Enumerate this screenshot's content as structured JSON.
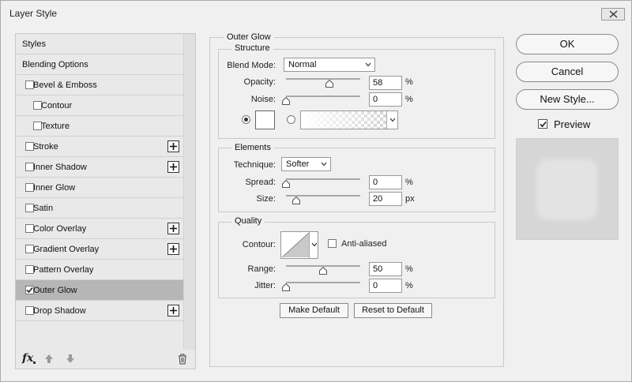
{
  "window": {
    "title": "Layer Style"
  },
  "sidebar": {
    "items": [
      {
        "label": "Styles",
        "checkbox": false,
        "checked": false,
        "indent": 0,
        "plus": false,
        "selected": false
      },
      {
        "label": "Blending Options",
        "checkbox": false,
        "checked": false,
        "indent": 0,
        "plus": false,
        "selected": false
      },
      {
        "label": "Bevel & Emboss",
        "checkbox": true,
        "checked": false,
        "indent": 0,
        "plus": false,
        "selected": false
      },
      {
        "label": "Contour",
        "checkbox": true,
        "checked": false,
        "indent": 1,
        "plus": false,
        "selected": false
      },
      {
        "label": "Texture",
        "checkbox": true,
        "checked": false,
        "indent": 1,
        "plus": false,
        "selected": false
      },
      {
        "label": "Stroke",
        "checkbox": true,
        "checked": false,
        "indent": 0,
        "plus": true,
        "selected": false
      },
      {
        "label": "Inner Shadow",
        "checkbox": true,
        "checked": false,
        "indent": 0,
        "plus": true,
        "selected": false
      },
      {
        "label": "Inner Glow",
        "checkbox": true,
        "checked": false,
        "indent": 0,
        "plus": false,
        "selected": false
      },
      {
        "label": "Satin",
        "checkbox": true,
        "checked": false,
        "indent": 0,
        "plus": false,
        "selected": false
      },
      {
        "label": "Color Overlay",
        "checkbox": true,
        "checked": false,
        "indent": 0,
        "plus": true,
        "selected": false
      },
      {
        "label": "Gradient Overlay",
        "checkbox": true,
        "checked": false,
        "indent": 0,
        "plus": true,
        "selected": false
      },
      {
        "label": "Pattern Overlay",
        "checkbox": true,
        "checked": false,
        "indent": 0,
        "plus": false,
        "selected": false
      },
      {
        "label": "Outer Glow",
        "checkbox": true,
        "checked": true,
        "indent": 0,
        "plus": false,
        "selected": true
      },
      {
        "label": "Drop Shadow",
        "checkbox": true,
        "checked": false,
        "indent": 0,
        "plus": true,
        "selected": false
      }
    ],
    "footer_icons": [
      "fx-icon",
      "move-up-icon",
      "move-down-icon",
      "trash-icon"
    ]
  },
  "outer_glow": {
    "title": "Outer Glow",
    "structure": {
      "title": "Structure",
      "blend_mode_label": "Blend Mode:",
      "blend_mode_value": "Normal",
      "opacity_label": "Opacity:",
      "opacity_value": "58",
      "opacity_unit": "%",
      "opacity_level": 0.58,
      "noise_label": "Noise:",
      "noise_value": "0",
      "noise_unit": "%",
      "noise_level": 0,
      "color_mode": "solid",
      "swatch_color": "#ffffff"
    },
    "elements": {
      "title": "Elements",
      "technique_label": "Technique:",
      "technique_value": "Softer",
      "spread_label": "Spread:",
      "spread_value": "0",
      "spread_unit": "%",
      "spread_level": 0,
      "size_label": "Size:",
      "size_value": "20",
      "size_unit": "px"
    },
    "quality": {
      "title": "Quality",
      "contour_label": "Contour:",
      "anti_aliased_label": "Anti-aliased",
      "anti_aliased_checked": false,
      "range_label": "Range:",
      "range_value": "50",
      "range_unit": "%",
      "range_level": 0.5,
      "jitter_label": "Jitter:",
      "jitter_value": "0",
      "jitter_unit": "%",
      "jitter_level": 0
    },
    "make_default_label": "Make Default",
    "reset_default_label": "Reset to Default"
  },
  "actions": {
    "ok_label": "OK",
    "cancel_label": "Cancel",
    "new_style_label": "New Style...",
    "preview_label": "Preview",
    "preview_checked": true
  },
  "colors": {
    "selected_row": "#b6b6b6",
    "dialog_bg": "#f0f0f0"
  }
}
